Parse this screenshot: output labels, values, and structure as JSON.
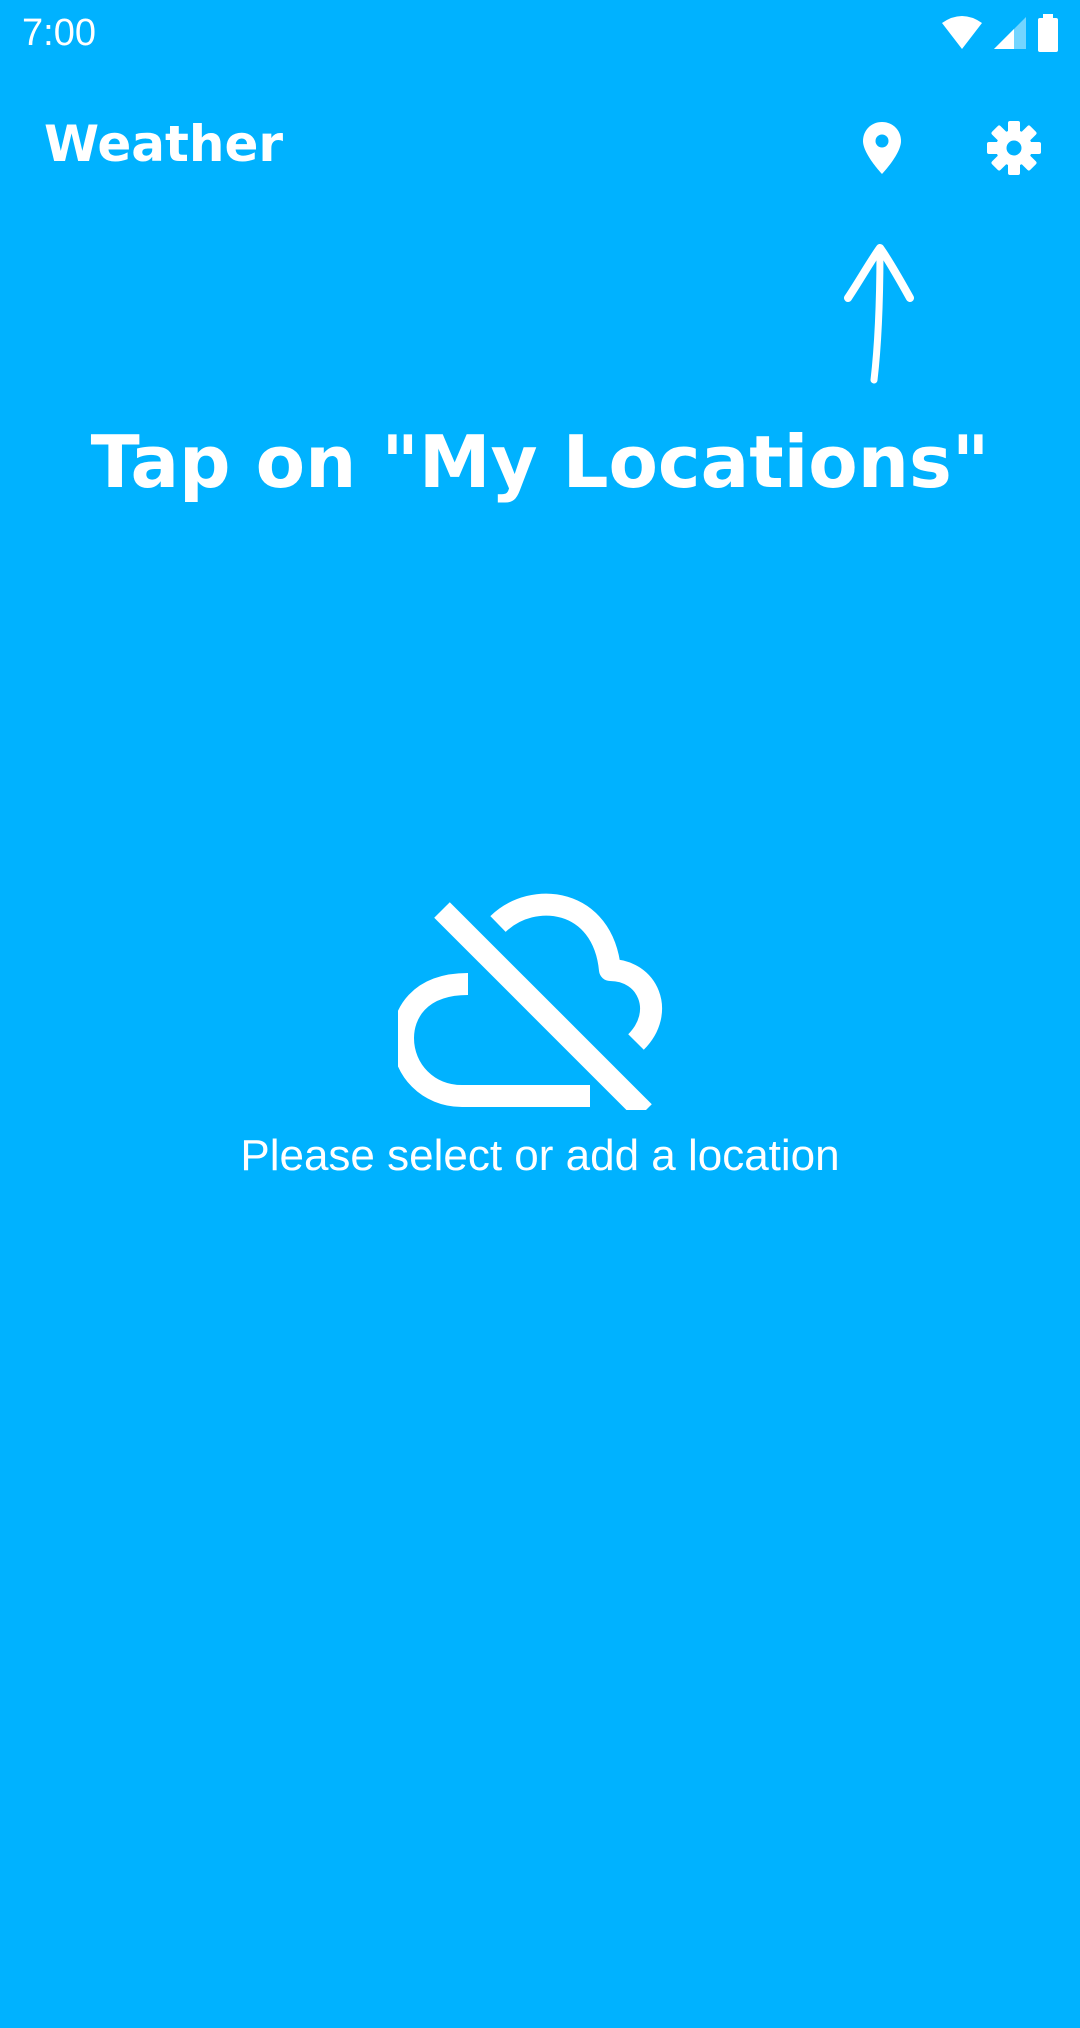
{
  "status_bar": {
    "time": "7:00",
    "icons": [
      "wifi-icon",
      "cellular-signal-icon",
      "battery-icon"
    ]
  },
  "app_bar": {
    "title": "Weather",
    "actions": [
      {
        "name": "my-locations-button",
        "icon": "location-pin-icon"
      },
      {
        "name": "settings-button",
        "icon": "gear-icon"
      }
    ]
  },
  "tutorial_overlay": {
    "hint": "Tap on \"My Locations\"",
    "arrow_icon": "hand-drawn-arrow-up-icon"
  },
  "empty_state": {
    "icon": "cloud-off-icon",
    "message": "Please select or add a location"
  },
  "colors": {
    "background": "#00B2FF",
    "foreground": "#FFFFFF"
  }
}
